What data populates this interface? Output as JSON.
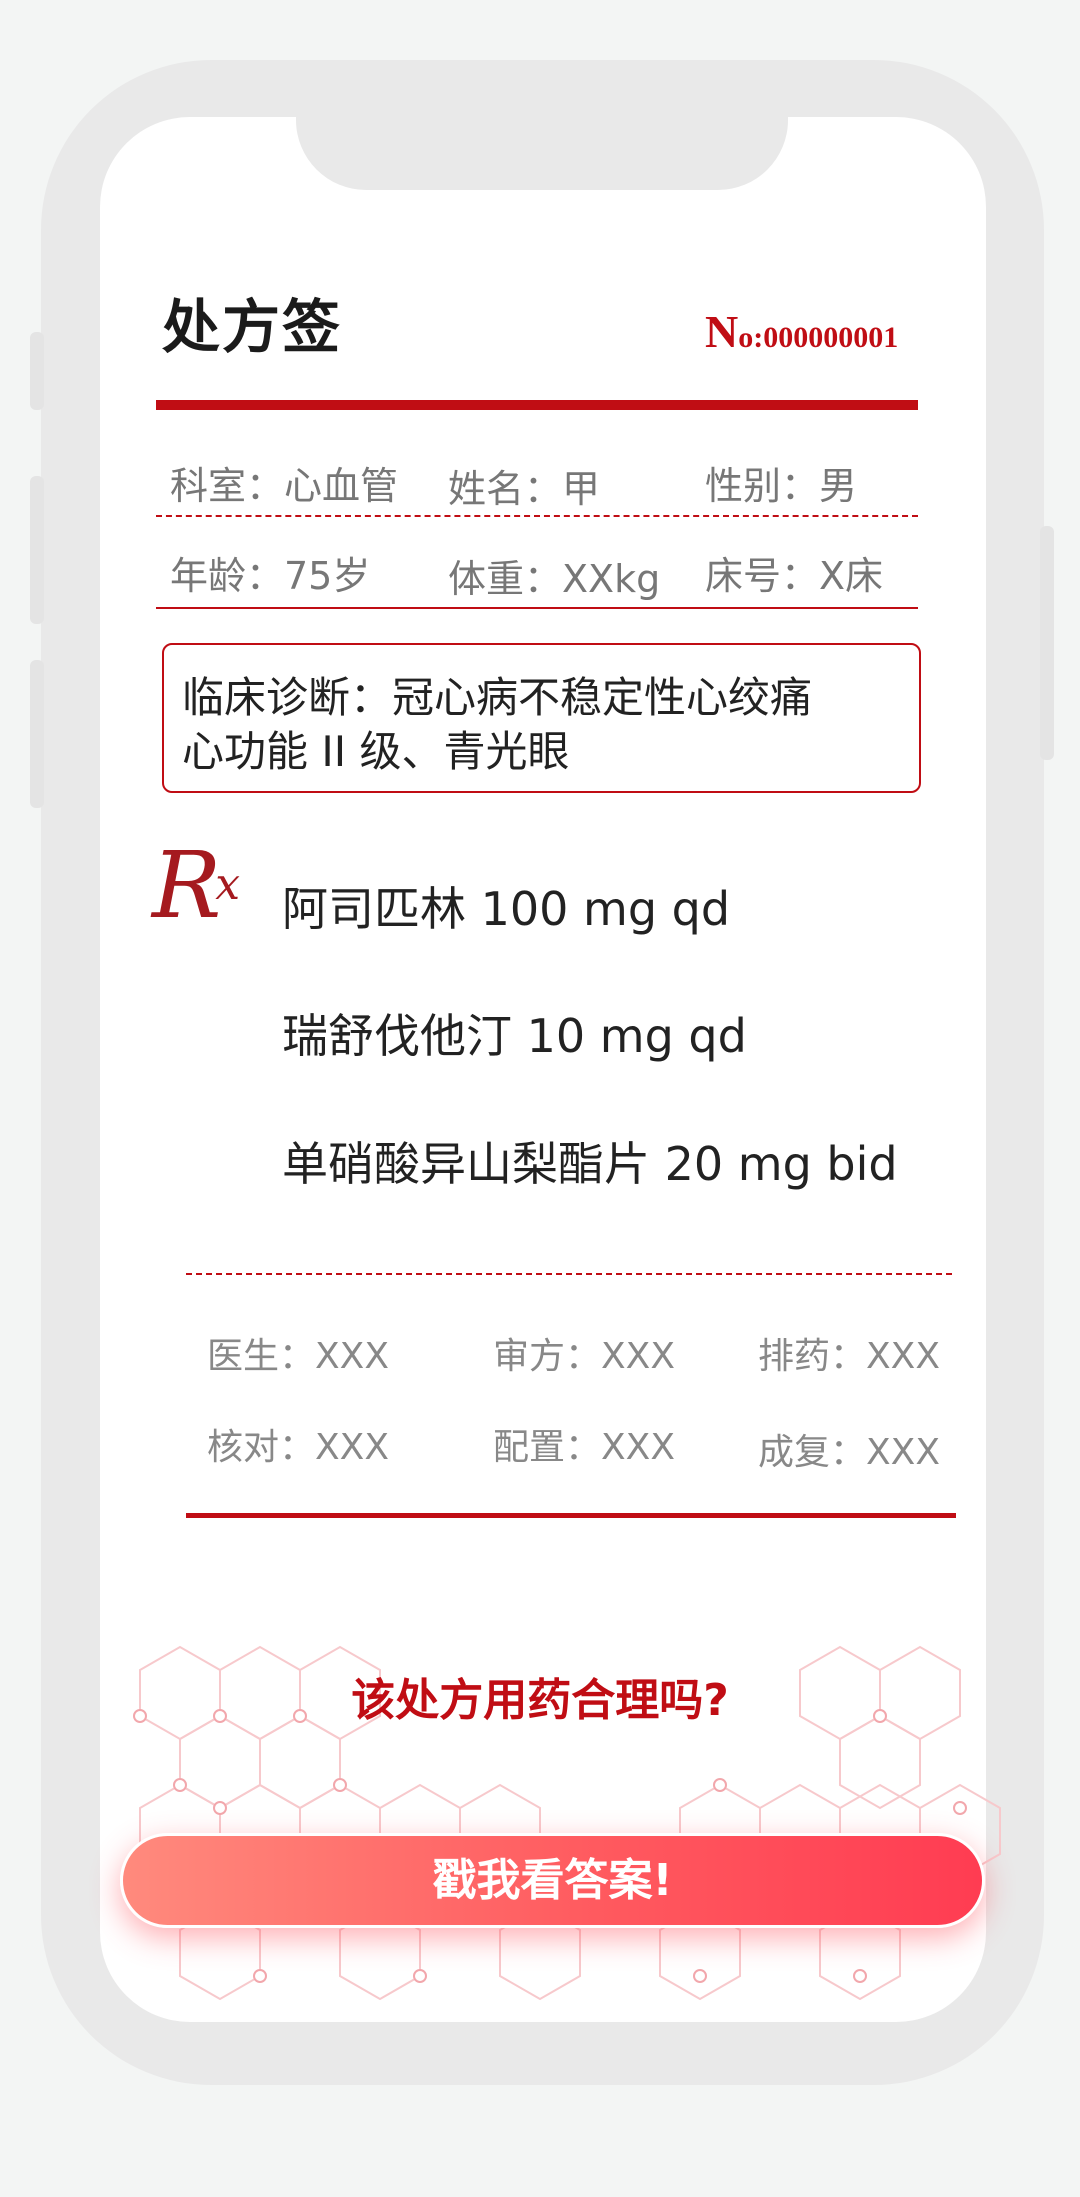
{
  "header": {
    "title": "处方签",
    "number_prefix": "N",
    "number_rest": "o:000000001"
  },
  "patient": {
    "department": "科室：心血管",
    "name": "姓名：甲",
    "gender": "性别：男",
    "age": "年龄：75岁",
    "weight": "体重：XXkg",
    "bed": "床号：X床"
  },
  "diagnosis": {
    "line1": "临床诊断：冠心病不稳定性心绞痛",
    "line2": "心功能 II 级、青光眼"
  },
  "rx": {
    "r": "R",
    "x": "x"
  },
  "drugs": [
    "阿司匹林 100 mg qd",
    "瑞舒伐他汀 10 mg qd",
    "单硝酸异山梨酯片 20 mg bid"
  ],
  "staff": {
    "doctor_label": "医生：",
    "doctor_value": "XXX",
    "review_label": "审方：",
    "review_value": "XXX",
    "dispense_label": "排药：",
    "dispense_value": "XXX",
    "check_label": "核对：",
    "check_value": "XXX",
    "prepare_label": "配置：",
    "prepare_value": "XXX",
    "recheck_label": "成复：",
    "recheck_value": "XXX"
  },
  "question": "该处方用药合理吗?",
  "cta_label": "戳我看答案!",
  "colors": {
    "accent": "#c00d14",
    "cta_start": "#ff8a7d",
    "cta_end": "#ff3c52"
  }
}
